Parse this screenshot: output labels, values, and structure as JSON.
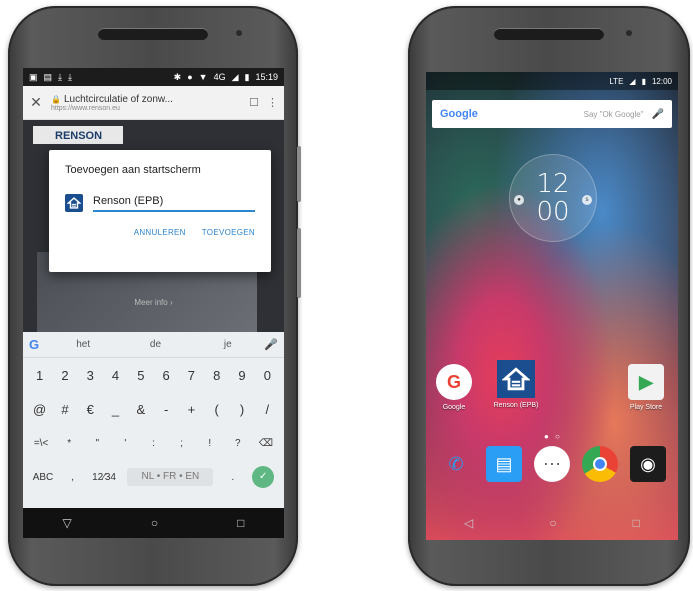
{
  "left_phone": {
    "status": {
      "time": "15:19",
      "network": "4G"
    },
    "browser": {
      "close_glyph": "✕",
      "page_title": "Luchtcirculatie of zonw...",
      "url": "https://www.renson.eu",
      "lock_icon": "lock-icon"
    },
    "webpage": {
      "brand": "RENSON",
      "more_info": "Meer info ›"
    },
    "dialog": {
      "title": "Toevoegen aan startscherm",
      "app_name": "Renson (EPB)",
      "cancel_label": "ANNULEREN",
      "add_label": "TOEVOEGEN"
    },
    "keyboard": {
      "suggestions": [
        "het",
        "de",
        "je"
      ],
      "row_numbers": [
        "1",
        "2",
        "3",
        "4",
        "5",
        "6",
        "7",
        "8",
        "9",
        "0"
      ],
      "row_symbols1": [
        "@",
        "#",
        "€",
        "_",
        "&",
        "-",
        "+",
        "(",
        ")",
        "/"
      ],
      "row_symbols2": [
        "=\\<",
        "*",
        "\"",
        "'",
        ":",
        ";",
        "!",
        "?",
        "⌫"
      ],
      "abc_label": "ABC",
      "comma": ",",
      "fraction_label": "12⁄34",
      "space_label": "NL • FR • EN",
      "period": "."
    }
  },
  "right_phone": {
    "status": {
      "network": "LTE",
      "time": "12:00"
    },
    "search": {
      "logo": "Google",
      "hint": "Say \"Ok Google\""
    },
    "clock": {
      "hours": "12",
      "minutes": "00"
    },
    "icons": {
      "google_label": "Google",
      "renson_label": "Renson (EPB)",
      "play_label": "Play Store"
    }
  },
  "colors": {
    "accent_blue": "#2c86d0",
    "renson_blue": "#1b4e8e",
    "enter_green": "#5fb884"
  }
}
